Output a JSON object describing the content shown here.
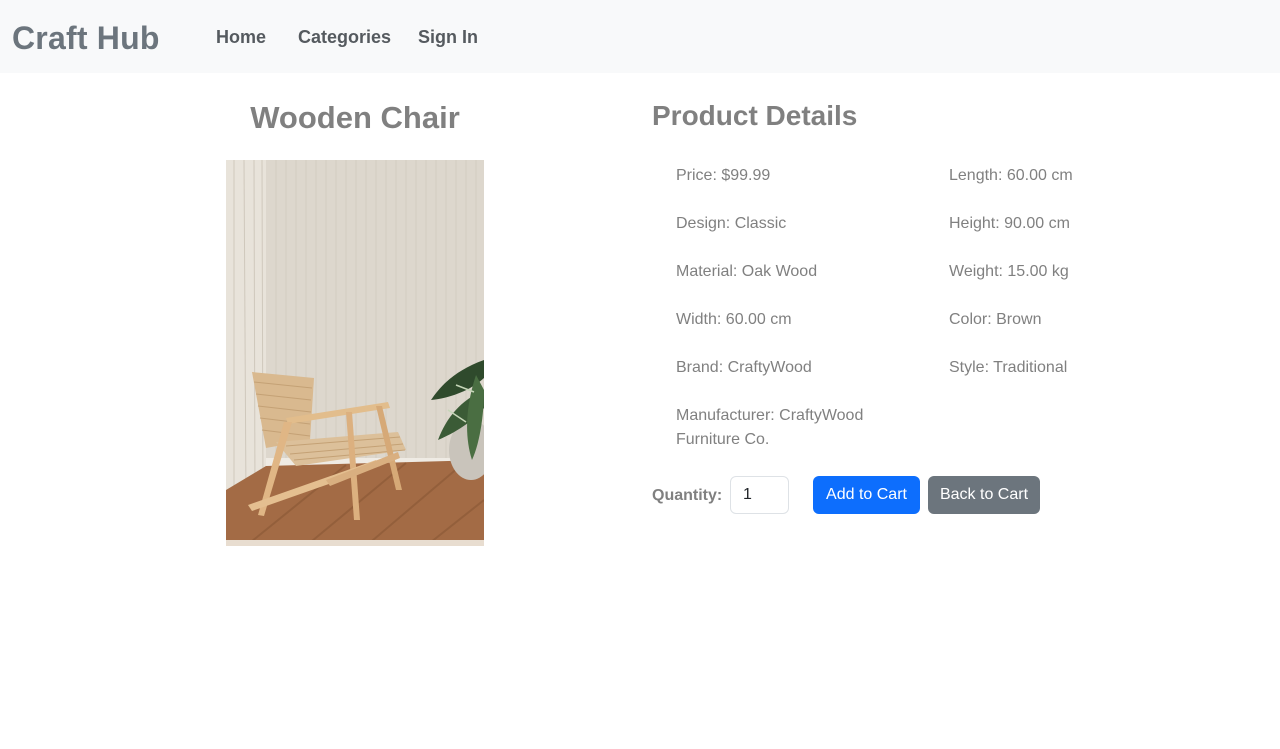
{
  "navbar": {
    "brand": "Craft Hub",
    "links": [
      "Home",
      "Categories",
      "Sign In"
    ]
  },
  "product": {
    "title": "Wooden Chair",
    "image_icon": "wooden-chair-photo"
  },
  "details": {
    "heading": "Product Details",
    "left_column": [
      "Price: $99.99",
      "Design: Classic",
      "Material: Oak Wood",
      "Width: 60.00 cm",
      "Brand: CraftyWood",
      "Manufacturer: CraftyWood Furniture Co."
    ],
    "right_column": [
      "Length: 60.00 cm",
      "Height: 90.00 cm",
      "Weight: 15.00 kg",
      "Color: Brown",
      "Style: Traditional"
    ]
  },
  "cart": {
    "quantity_label": "Quantity:",
    "quantity_value": "1",
    "add_button": "Add to Cart",
    "back_button": "Back to Cart"
  },
  "colors": {
    "navbar_bg": "#f8f9fa",
    "primary": "#0d6efd",
    "secondary": "#6c757d",
    "text_muted": "#808080"
  }
}
